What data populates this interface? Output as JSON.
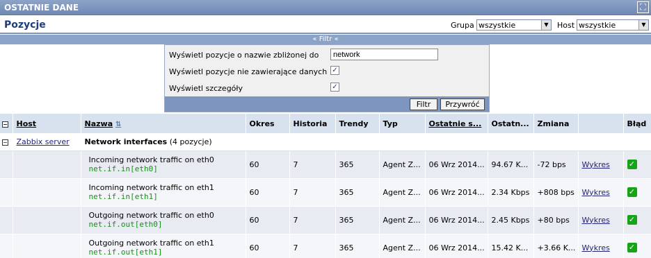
{
  "window": {
    "title": "OSTATNIE DANE",
    "fullscreen_icon": "fullscreen-icon"
  },
  "header": {
    "page_title": "Pozycje",
    "group_label": "Grupa",
    "group_value": "wszystkie",
    "host_label": "Host",
    "host_value": "wszystkie"
  },
  "filter": {
    "toggle_label": "« Filtr «",
    "name_label": "Wyświetl pozycje o nazwie zbliżonej do",
    "name_value": "network",
    "nodata_label": "Wyświetl pozycje nie zawierające danych",
    "nodata_checked": true,
    "details_label": "Wyświetl szczegóły",
    "details_checked": true,
    "filter_button": "Filtr",
    "reset_button": "Przywróć"
  },
  "table": {
    "columns": [
      "Host",
      "Nazwa",
      "Okres",
      "Historia",
      "Trendy",
      "Typ",
      "Ostatnie s...",
      "Ostatn...",
      "Zmiana",
      "",
      "Błąd"
    ],
    "group": {
      "host": "Zabbix server",
      "name": "Network interfaces",
      "count": "(4 pozycje)"
    },
    "rows": [
      {
        "name": "Incoming network traffic on eth0",
        "key": "net.if.in[eth0]",
        "period": "60",
        "history": "7",
        "trends": "365",
        "type": "Agent Z...",
        "last_check": "06 Wrz 2014...",
        "last_value": "94.67 K...",
        "change": "-72 bps",
        "graph": "Wykres"
      },
      {
        "name": "Incoming network traffic on eth1",
        "key": "net.if.in[eth1]",
        "period": "60",
        "history": "7",
        "trends": "365",
        "type": "Agent Z...",
        "last_check": "06 Wrz 2014...",
        "last_value": "2.34 Kbps",
        "change": "+808 bps",
        "graph": "Wykres"
      },
      {
        "name": "Outgoing network traffic on eth0",
        "key": "net.if.out[eth0]",
        "period": "60",
        "history": "7",
        "trends": "365",
        "type": "Agent Z...",
        "last_check": "06 Wrz 2014...",
        "last_value": "2.45 Kbps",
        "change": "+80 bps",
        "graph": "Wykres"
      },
      {
        "name": "Outgoing network traffic on eth1",
        "key": "net.if.out[eth1]",
        "period": "60",
        "history": "7",
        "trends": "365",
        "type": "Agent Z...",
        "last_check": "06 Wrz 2014...",
        "last_value": "15.42 K...",
        "change": "+3.66 K...",
        "graph": "Wykres"
      }
    ]
  },
  "colors": {
    "header_blue": "#7d95bd",
    "title_text": "#1c3e7e",
    "key_green": "#139113",
    "ok_green": "#16a416"
  }
}
